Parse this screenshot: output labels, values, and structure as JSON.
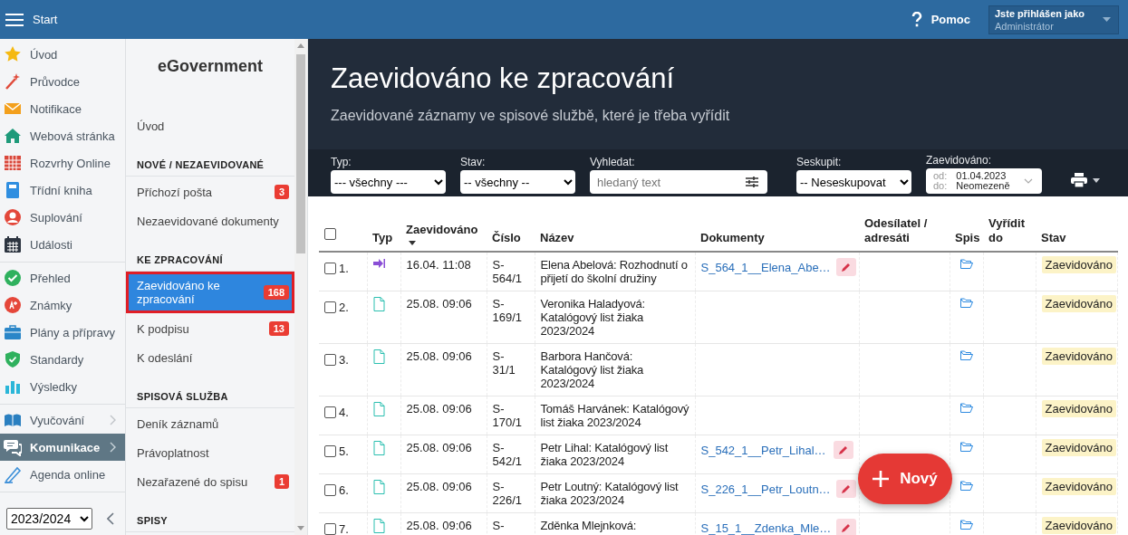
{
  "topbar": {
    "menu_label": "Start",
    "help": "Pomoc",
    "user": {
      "caption": "Jste přihlášen jako",
      "name": "Administrátor"
    }
  },
  "nav": {
    "groups": [
      [
        {
          "label": "Úvod",
          "selected": false,
          "expandable": false
        },
        {
          "label": "Průvodce",
          "selected": false,
          "expandable": false
        },
        {
          "label": "Notifikace",
          "selected": false,
          "expandable": false
        },
        {
          "label": "Webová stránka",
          "selected": false,
          "expandable": false
        },
        {
          "label": "Rozvrhy Online",
          "selected": false,
          "expandable": false
        },
        {
          "label": "Třídní kniha",
          "selected": false,
          "expandable": false
        },
        {
          "label": "Suplování",
          "selected": false,
          "expandable": false
        },
        {
          "label": "Události",
          "selected": false,
          "expandable": false
        }
      ],
      [
        {
          "label": "Přehled",
          "selected": false,
          "expandable": false
        },
        {
          "label": "Známky",
          "selected": false,
          "expandable": false
        },
        {
          "label": "Plány a přípravy",
          "selected": false,
          "expandable": false
        },
        {
          "label": "Standardy",
          "selected": false,
          "expandable": false
        },
        {
          "label": "Výsledky",
          "selected": false,
          "expandable": false
        }
      ],
      [
        {
          "label": "Vyučování",
          "selected": false,
          "expandable": true
        },
        {
          "label": "Komunikace",
          "selected": true,
          "expandable": true
        },
        {
          "label": "Agenda online",
          "selected": false,
          "expandable": false
        }
      ]
    ],
    "year": "2023/2024"
  },
  "submenu": {
    "title": "eGovernment",
    "sections": [
      {
        "items": [
          {
            "label": "Úvod",
            "selected": false
          }
        ]
      },
      {
        "heading": "NOVÉ / NEZAEVIDOVANÉ",
        "items": [
          {
            "label": "Příchozí pošta",
            "badge": "3",
            "selected": false
          },
          {
            "label": "Nezaevidované dokumenty",
            "selected": false
          }
        ]
      },
      {
        "heading": "KE ZPRACOVÁNÍ",
        "items": [
          {
            "label": "Zaevidováno ke zpracování",
            "badge": "168",
            "selected": true
          },
          {
            "label": "K podpisu",
            "badge": "13",
            "selected": false
          },
          {
            "label": "K odeslání",
            "selected": false
          }
        ]
      },
      {
        "heading": "SPISOVÁ SLUŽBA",
        "items": [
          {
            "label": "Deník záznamů",
            "selected": false
          },
          {
            "label": "Právoplatnost",
            "selected": false
          },
          {
            "label": "Nezařazené do spisu",
            "badge": "1",
            "selected": false
          }
        ]
      },
      {
        "heading": "SPISY"
      }
    ]
  },
  "page": {
    "title": "Zaevidováno ke zpracování",
    "subtitle": "Zaevidované záznamy ve spisové službě, které je třeba vyřídit"
  },
  "filters": [
    {
      "kind": "select",
      "label": "Typ:",
      "value": "--- všechny ---"
    },
    {
      "kind": "select",
      "label": "Stav:",
      "value": "-- všechny --"
    },
    {
      "kind": "search",
      "label": "Vyhledat:",
      "placeholder": "hledaný text"
    },
    {
      "kind": "select",
      "label": "Seskupit:",
      "value": "-- Neseskupovat"
    },
    {
      "kind": "daterange",
      "label": "Zaevidováno:",
      "from_label": "od:",
      "from": "01.04.2023",
      "to_label": "do:",
      "to": "Neomezeně"
    }
  ],
  "table": {
    "all_checked": false,
    "columns": [
      {
        "label": "Typ",
        "sorted": false
      },
      {
        "label": "Zaevidováno",
        "sorted": true
      },
      {
        "label": "Číslo",
        "sorted": false
      },
      {
        "label": "Název",
        "sorted": false
      },
      {
        "label": "Dokumenty",
        "sorted": false
      },
      {
        "label": "Odesílatel / adresáti",
        "sorted": false
      },
      {
        "label": "Spis",
        "sorted": false
      },
      {
        "label": "Vyřídit do",
        "sorted": false
      },
      {
        "label": "Stav",
        "sorted": false
      }
    ],
    "rows": [
      {
        "checked": false,
        "index": "1.",
        "kind": "forward",
        "date": "16.04. 11:08",
        "number": "S-564/1",
        "title": "Elena Abelová: Rozhodnutí o přijetí do školní družiny",
        "document": "S_564_1__Elena_Abe…",
        "status": "Zaevidováno"
      },
      {
        "checked": false,
        "index": "2.",
        "kind": "file",
        "date": "25.08. 09:06",
        "number": "S-169/1",
        "title": "Veronika Haladyová: Katalógový list žiaka 2023/2024",
        "status": "Zaevidováno"
      },
      {
        "checked": false,
        "index": "3.",
        "kind": "file",
        "date": "25.08. 09:06",
        "number": "S-31/1",
        "title": "Barbora Hančová: Katalógový list žiaka 2023/2024",
        "status": "Zaevidováno"
      },
      {
        "checked": false,
        "index": "4.",
        "kind": "file",
        "date": "25.08. 09:06",
        "number": "S-170/1",
        "title": "Tomáš Harvánek: Katalógový list žiaka 2023/2024",
        "status": "Zaevidováno"
      },
      {
        "checked": false,
        "index": "5.",
        "kind": "file",
        "date": "25.08. 09:06",
        "number": "S-542/1",
        "title": "Petr Lihal: Katalógový list žiaka 2023/2024",
        "document": "S_542_1__Petr_Lihal…",
        "status": "Zaevidováno"
      },
      {
        "checked": false,
        "index": "6.",
        "kind": "file",
        "date": "25.08. 09:06",
        "number": "S-226/1",
        "title": "Petr Loutný: Katalógový list žiaka 2023/2024",
        "document": "S_226_1__Petr_Loutn…",
        "status": "Zaevidováno"
      },
      {
        "checked": false,
        "index": "7.",
        "kind": "file",
        "date": "25.08. 09:06",
        "number": "S-",
        "title": "Zděnka Mlejnková:",
        "document": "S_15_1__Zdenka_Mle…",
        "status": "Zaevidováno"
      }
    ]
  },
  "fab": {
    "label": "Nový"
  }
}
